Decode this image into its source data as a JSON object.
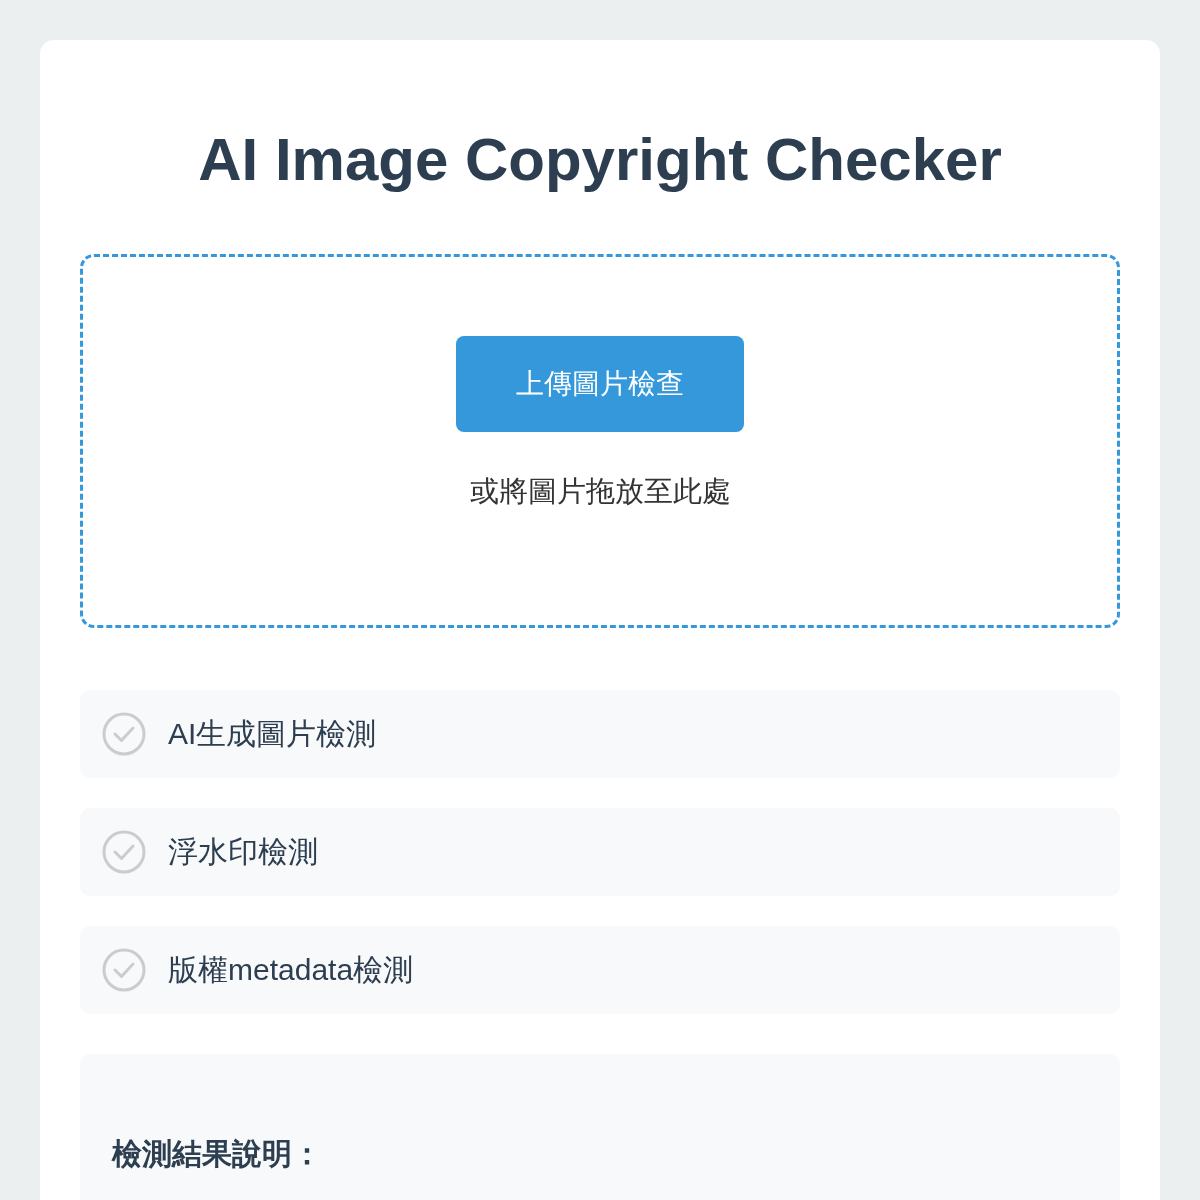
{
  "title": "AI Image Copyright Checker",
  "upload": {
    "button": "上傳圖片檢查",
    "hint": "或將圖片拖放至此處"
  },
  "checks": [
    {
      "label": "AI生成圖片檢測",
      "checked": false
    },
    {
      "label": "浮水印檢測",
      "checked": false
    },
    {
      "label": "版權metadata檢測",
      "checked": false
    }
  ],
  "results": {
    "heading": "檢測結果說明："
  }
}
